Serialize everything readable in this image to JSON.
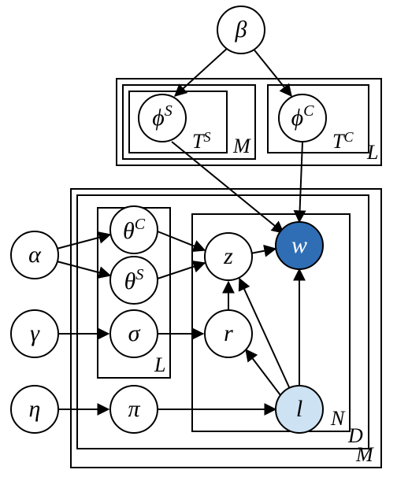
{
  "nodes": {
    "beta": {
      "label": "β",
      "sup": ""
    },
    "phiS": {
      "label": "ϕ",
      "sup": "S"
    },
    "phiC": {
      "label": "ϕ",
      "sup": "C"
    },
    "alpha": {
      "label": "α",
      "sup": ""
    },
    "gamma": {
      "label": "γ",
      "sup": ""
    },
    "eta": {
      "label": "η",
      "sup": ""
    },
    "thetaC": {
      "label": "θ",
      "sup": "C"
    },
    "thetaS": {
      "label": "θ",
      "sup": "S"
    },
    "sigma": {
      "label": "σ",
      "sup": ""
    },
    "pi": {
      "label": "π",
      "sup": ""
    },
    "z": {
      "label": "z",
      "sup": ""
    },
    "r": {
      "label": "r",
      "sup": ""
    },
    "w": {
      "label": "w",
      "sup": ""
    },
    "l": {
      "label": "l",
      "sup": ""
    }
  },
  "plates": {
    "TS": {
      "label": "T",
      "sup": "S"
    },
    "M_outer_small": {
      "label": "M",
      "sup": ""
    },
    "TC": {
      "label": "T",
      "sup": "C"
    },
    "L_top": {
      "label": "L",
      "sup": ""
    },
    "L_inner": {
      "label": "L",
      "sup": ""
    },
    "N": {
      "label": "N",
      "sup": ""
    },
    "D": {
      "label": "D",
      "sup": ""
    },
    "M_outer_big": {
      "label": "M",
      "sup": ""
    }
  },
  "chart_data": {
    "type": "graph",
    "description": "Plate-notation probabilistic graphical model",
    "nodes": [
      {
        "id": "beta",
        "observed": false
      },
      {
        "id": "phiS",
        "observed": false,
        "plates": [
          "TS",
          "M_outer_small",
          "L_top"
        ]
      },
      {
        "id": "phiC",
        "observed": false,
        "plates": [
          "TC",
          "L_top"
        ]
      },
      {
        "id": "alpha",
        "observed": false
      },
      {
        "id": "gamma",
        "observed": false
      },
      {
        "id": "eta",
        "observed": false
      },
      {
        "id": "thetaC",
        "observed": false,
        "plates": [
          "L_inner",
          "D",
          "M_outer_big"
        ]
      },
      {
        "id": "thetaS",
        "observed": false,
        "plates": [
          "L_inner",
          "D",
          "M_outer_big"
        ]
      },
      {
        "id": "sigma",
        "observed": false,
        "plates": [
          "L_inner",
          "D",
          "M_outer_big"
        ]
      },
      {
        "id": "pi",
        "observed": false,
        "plates": [
          "D",
          "M_outer_big"
        ]
      },
      {
        "id": "z",
        "observed": false,
        "plates": [
          "N",
          "D",
          "M_outer_big"
        ]
      },
      {
        "id": "r",
        "observed": false,
        "plates": [
          "N",
          "D",
          "M_outer_big"
        ]
      },
      {
        "id": "w",
        "observed": true,
        "shade": "dark",
        "plates": [
          "N",
          "D",
          "M_outer_big"
        ]
      },
      {
        "id": "l",
        "observed": true,
        "shade": "light",
        "plates": [
          "N",
          "D",
          "M_outer_big"
        ]
      }
    ],
    "edges": [
      [
        "beta",
        "phiS"
      ],
      [
        "beta",
        "phiC"
      ],
      [
        "phiS",
        "w"
      ],
      [
        "phiC",
        "w"
      ],
      [
        "alpha",
        "thetaC"
      ],
      [
        "alpha",
        "thetaS"
      ],
      [
        "gamma",
        "sigma"
      ],
      [
        "eta",
        "pi"
      ],
      [
        "thetaC",
        "z"
      ],
      [
        "thetaS",
        "z"
      ],
      [
        "sigma",
        "r"
      ],
      [
        "pi",
        "l"
      ],
      [
        "r",
        "z"
      ],
      [
        "z",
        "w"
      ],
      [
        "l",
        "z"
      ],
      [
        "l",
        "r"
      ],
      [
        "l",
        "w"
      ]
    ],
    "plates": [
      "TS",
      "M_outer_small",
      "TC",
      "L_top",
      "L_inner",
      "N",
      "D",
      "M_outer_big"
    ]
  }
}
